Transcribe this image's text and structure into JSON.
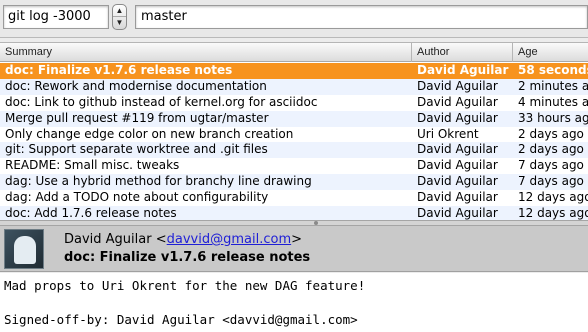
{
  "toolbar": {
    "query_value": "git log -3000",
    "stepper_up": "▲",
    "stepper_down": "▼",
    "branch_value": "master"
  },
  "table": {
    "headers": [
      "Summary",
      "Author",
      "Age"
    ],
    "rows": [
      {
        "summary": "doc: Finalize v1.7.6 release notes",
        "author": "David Aguilar",
        "age": "58 seconds ago",
        "selected": true
      },
      {
        "summary": "doc: Rework and modernise documentation",
        "author": "David Aguilar",
        "age": "2 minutes ago"
      },
      {
        "summary": "doc: Link to github instead of kernel.org for asciidoc",
        "author": "David Aguilar",
        "age": "4 minutes ago"
      },
      {
        "summary": "Merge pull request #119 from ugtar/master",
        "author": "David Aguilar",
        "age": "33 hours ago"
      },
      {
        "summary": "Only change edge color on new branch creation",
        "author": "Uri Okrent",
        "age": "2 days ago"
      },
      {
        "summary": "git: Support separate worktree and .git files",
        "author": "David Aguilar",
        "age": "2 days ago"
      },
      {
        "summary": "README: Small misc. tweaks",
        "author": "David Aguilar",
        "age": "7 days ago"
      },
      {
        "summary": "dag: Use a hybrid method for branchy line drawing",
        "author": "David Aguilar",
        "age": "7 days ago"
      },
      {
        "summary": "dag: Add a TODO note about configurability",
        "author": "David Aguilar",
        "age": "12 days ago"
      },
      {
        "summary": "doc: Add 1.7.6 release notes",
        "author": "David Aguilar",
        "age": "12 days ago"
      }
    ],
    "selected_color": "#f7931e"
  },
  "commit": {
    "author_name": "David Aguilar",
    "email_open": "<",
    "email": "davvid@gmail.com",
    "email_close": ">",
    "subject": "doc: Finalize v1.7.6 release notes",
    "avatar_icon": "user-avatar-icon"
  },
  "message": {
    "lines": [
      "Mad props to Uri Okrent for the new DAG feature!",
      "",
      "Signed-off-by: David Aguilar <davvid@gmail.com>"
    ]
  }
}
